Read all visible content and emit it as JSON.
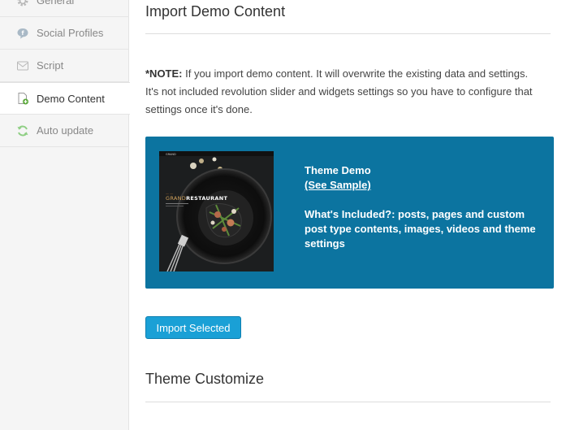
{
  "sidebar": {
    "items": [
      {
        "label": "General",
        "icon": "gear-icon",
        "active": false
      },
      {
        "label": "Social Profiles",
        "icon": "chat-bubble-icon",
        "active": false
      },
      {
        "label": "Script",
        "icon": "script-icon",
        "active": false
      },
      {
        "label": "Demo Content",
        "icon": "document-add-icon",
        "active": true
      },
      {
        "label": "Auto update",
        "icon": "refresh-icon",
        "active": false
      }
    ]
  },
  "main": {
    "import_section_title": "Import Demo Content",
    "note": {
      "label": "*NOTE:",
      "text": " If you import demo content. It will overwrite the existing data and settings. It's not included revolution slider and widgets settings so you have to configure that settings once it's done."
    },
    "demo": {
      "thumbnail_logo_small": "GRAND",
      "thumbnail_brand_prefix": "GRAND",
      "thumbnail_brand_suffix": "RESTAURANT",
      "name": "Theme Demo",
      "sample_link": "(See Sample)",
      "included": "What's Included?: posts, pages and custom post type contents, images, videos and theme settings"
    },
    "import_button": "Import Selected",
    "customize_section_title": "Theme Customize"
  },
  "colors": {
    "card_background": "#0c74a0",
    "button_background": "#1aa0d6",
    "sidebar_background": "#f5f5f5"
  }
}
